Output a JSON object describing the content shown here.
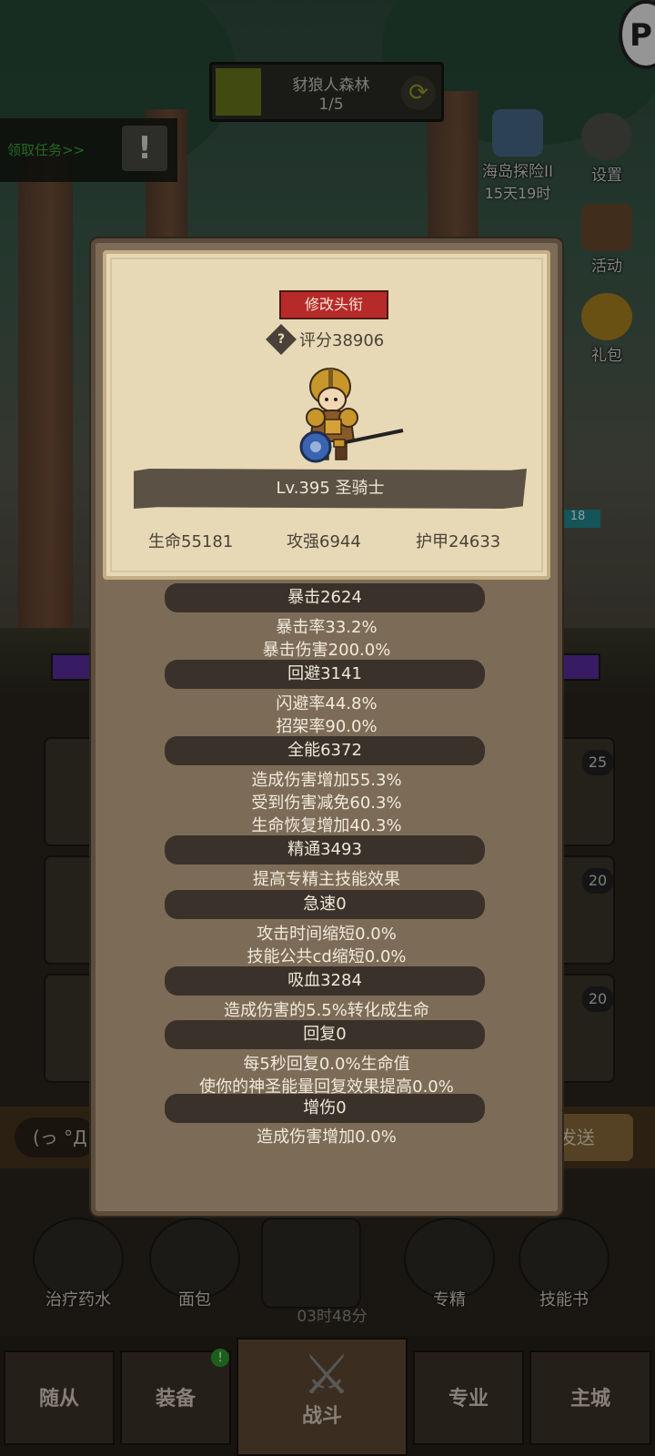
{
  "stage": {
    "name": "豺狼人森林",
    "progress": "1/5"
  },
  "quest": {
    "label": "领取任务>>",
    "icon_glyph": "!"
  },
  "side_menu": {
    "island": {
      "label": "海岛探险II",
      "sub": "15天19时"
    },
    "settings": {
      "label": "设置"
    },
    "events": {
      "label": "活动"
    },
    "gift": {
      "label": "礼包"
    }
  },
  "scene": {
    "hp_badge": "18",
    "slot_levels": [
      "25",
      "20",
      "20"
    ]
  },
  "chat": {
    "emote": "(っ °Д °;",
    "send": "发送"
  },
  "consumables": [
    {
      "label": "治疗药水"
    },
    {
      "label": "面包"
    },
    {
      "label": "专精"
    },
    {
      "label": "技能书"
    }
  ],
  "timer": "03时48分",
  "nav": {
    "tabs": [
      "随从",
      "装备",
      "战斗",
      "专业",
      "主城"
    ],
    "badge": "!"
  },
  "character": {
    "edit_title": "修改头衔",
    "score": "评分38906",
    "class_banner": "Lv.395 圣骑士",
    "hp": "生命55181",
    "attack": "攻强6944",
    "armor": "护甲24633"
  },
  "stats": [
    {
      "header": "暴击2624",
      "lines": [
        "暴击率33.2%",
        "暴击伤害200.0%"
      ]
    },
    {
      "header": "回避3141",
      "lines": [
        "闪避率44.8%",
        "招架率90.0%"
      ]
    },
    {
      "header": "全能6372",
      "lines": [
        "造成伤害增加55.3%",
        "受到伤害减免60.3%",
        "生命恢复增加40.3%"
      ]
    },
    {
      "header": "精通3493",
      "lines": [
        "提高专精主技能效果"
      ]
    },
    {
      "header": "急速0",
      "lines": [
        "攻击时间缩短0.0%",
        "技能公共cd缩短0.0%"
      ]
    },
    {
      "header": "吸血3284",
      "lines": [
        "造成伤害的5.5%转化成生命"
      ]
    },
    {
      "header": "回复0",
      "lines": [
        "每5秒回复0.0%生命值",
        "使你的神圣能量回复效果提高0.0%"
      ]
    },
    {
      "header": "增伤0",
      "lines": [
        "造成伤害增加0.0%"
      ]
    }
  ]
}
